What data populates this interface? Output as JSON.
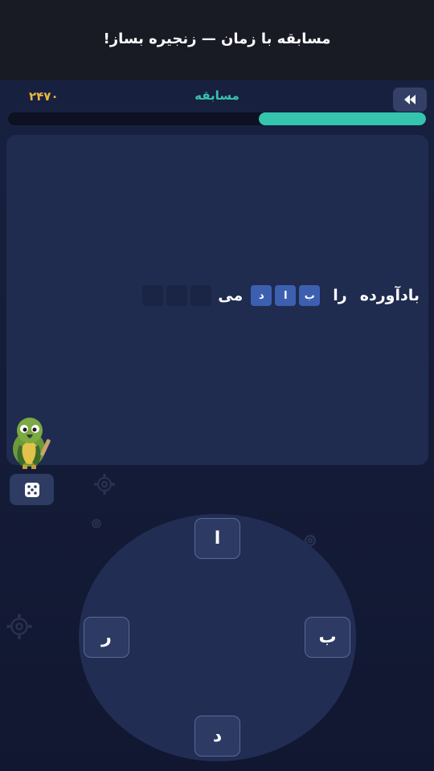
{
  "header": {
    "title": "مسابقه با زمان — زنجیره بساز!"
  },
  "status": {
    "score": "۲۴۷۰",
    "mode": "مسابقه",
    "back_icon": "rewind-icon",
    "timer_progress": 0.4,
    "timer_color": "#35c4ad",
    "score_color": "#e9b73e"
  },
  "puzzle": {
    "word_start": "بادآورده",
    "connector": "را",
    "answer_letters": [
      "ب",
      "ا",
      "د"
    ],
    "word_end": "می",
    "empty_slots": 3
  },
  "mascot_icon": "parrot-mascot",
  "dice_icon": "dice-icon",
  "wheel": {
    "letters": {
      "top": "ا",
      "right": "ب",
      "bottom": "د",
      "left": "ر"
    }
  }
}
